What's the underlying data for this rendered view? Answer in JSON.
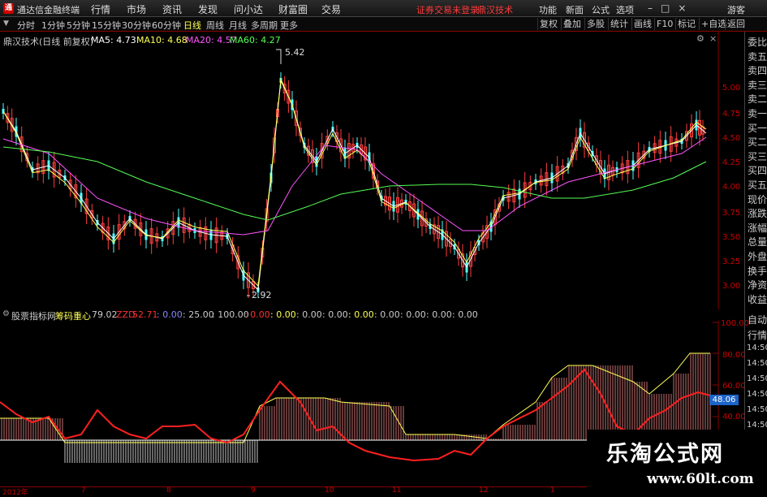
{
  "app": {
    "logo_glyph": "通",
    "title": "通达信金融终端"
  },
  "menu": [
    "行情",
    "市场",
    "资讯",
    "发现",
    "问小达",
    "财富圈",
    "交易"
  ],
  "warning": {
    "text": "证券交易未登录",
    "name": "鼎汉技术"
  },
  "right_menu": [
    "功能",
    "新面",
    "公式",
    "选项",
    "游客"
  ],
  "period_tabs": [
    "分时",
    "1分钟",
    "5分钟",
    "15分钟",
    "30分钟",
    "60分钟",
    "日线",
    "周线",
    "月线",
    "多周期",
    "更多"
  ],
  "period_selected": "日线",
  "right_tools": [
    "复权",
    "叠加",
    "多股",
    "统计",
    "画线",
    "F10",
    "标记",
    "+自选",
    "返回"
  ],
  "chart_title": "鼎汉技术(日线 前复权)",
  "ma_legend": [
    {
      "text": "MA5: 4.73",
      "color": "#ffffff"
    },
    {
      "text": "MA10: 4.68",
      "color": "#ffff54"
    },
    {
      "text": "MA20: 4.57",
      "color": "#ff54ff"
    },
    {
      "text": "MA60: 4.27",
      "color": "#54ff54"
    }
  ],
  "price_axis": [
    "5.00",
    "4.75",
    "4.50",
    "4.25",
    "4.00",
    "3.75",
    "3.50",
    "3.25",
    "3.00"
  ],
  "annotations": {
    "high": "5.42",
    "low": "2.92"
  },
  "side_labels": [
    "委比",
    "卖五",
    "卖四",
    "卖三",
    "卖二",
    "卖一",
    "买一",
    "买二",
    "买三",
    "买四",
    "买五",
    "现价",
    "涨跌",
    "涨幅",
    "总量",
    "外盘",
    "换手",
    "净资",
    "收益"
  ],
  "indicator": {
    "name": "股票指标网",
    "formula": "筹码重心",
    "value1": "79.02",
    "zzd_label": "ZZD",
    "zzd_value": "52.71",
    "extra": [
      ": 0.00",
      ": 25.00",
      ": 100.00",
      ": 0.00",
      ": 0.00",
      ": 0.00",
      ": 0.00",
      ": 0.00",
      ": 0.00",
      ": 0.00",
      ": 0.00",
      ": 0.00"
    ]
  },
  "sub_axis": [
    "100.00",
    "80.00",
    "60.00",
    "40.00"
  ],
  "sub_badge": "48.06",
  "side2_labels": [
    "自动",
    "行情",
    "14:50",
    "14:50",
    "14:50",
    "14:50",
    "14:50",
    "14:50",
    "14:50",
    "14:50"
  ],
  "x_axis": [
    "2012年",
    "7",
    "8",
    "9",
    "10",
    "11",
    "12",
    "1"
  ],
  "watermark": {
    "cn": "乐淘公式网",
    "url": "www.60lt.com"
  }
}
